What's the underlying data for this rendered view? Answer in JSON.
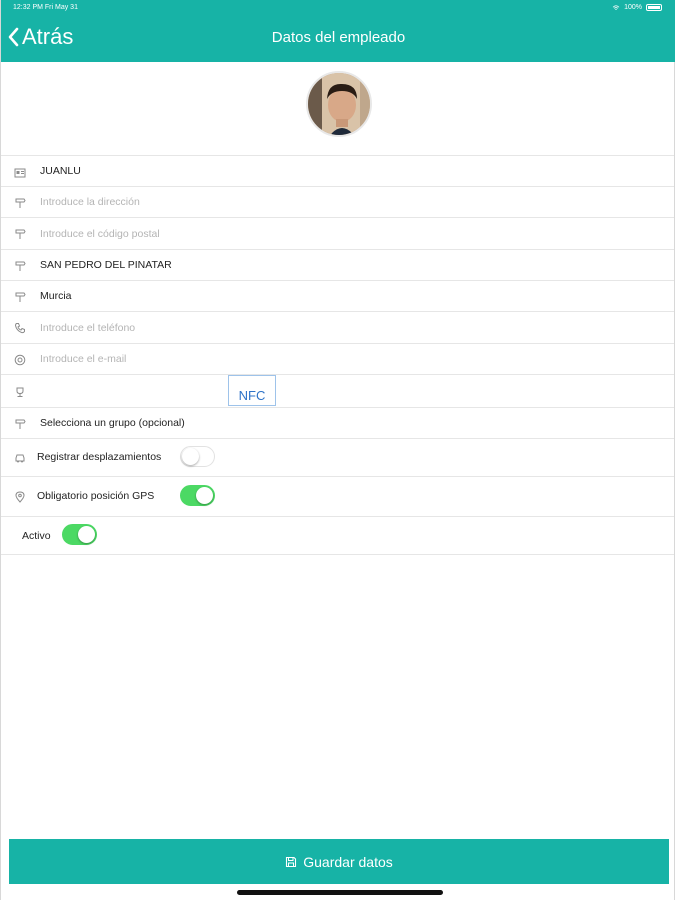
{
  "status_bar": {
    "time": "12:32 PM   Fri May 31",
    "battery": "100%"
  },
  "header": {
    "back_label": "Atrás",
    "title": "Datos del empleado"
  },
  "form": {
    "name": {
      "value": "JUANLU",
      "placeholder": ""
    },
    "address": {
      "value": "",
      "placeholder": "Introduce la dirección"
    },
    "postal_code": {
      "value": "",
      "placeholder": "Introduce el código postal"
    },
    "city": {
      "value": "SAN PEDRO DEL PINATAR",
      "placeholder": ""
    },
    "province": {
      "value": "Murcia",
      "placeholder": ""
    },
    "phone": {
      "value": "",
      "placeholder": "Introduce el teléfono"
    },
    "email": {
      "value": "",
      "placeholder": "Introduce el e-mail"
    },
    "nfc_label": "NFC",
    "group_label": "Selecciona un grupo (opcional)",
    "register_travel": {
      "label": "Registrar desplazamientos",
      "on": false
    },
    "gps_required": {
      "label": "Obligatorio posición GPS",
      "on": true
    },
    "active": {
      "label": "Activo",
      "on": true
    }
  },
  "save_button": {
    "label": "Guardar datos"
  },
  "colors": {
    "accent": "#17b3a6",
    "toggle_on": "#4cd964",
    "nfc_text": "#2e73c8"
  }
}
